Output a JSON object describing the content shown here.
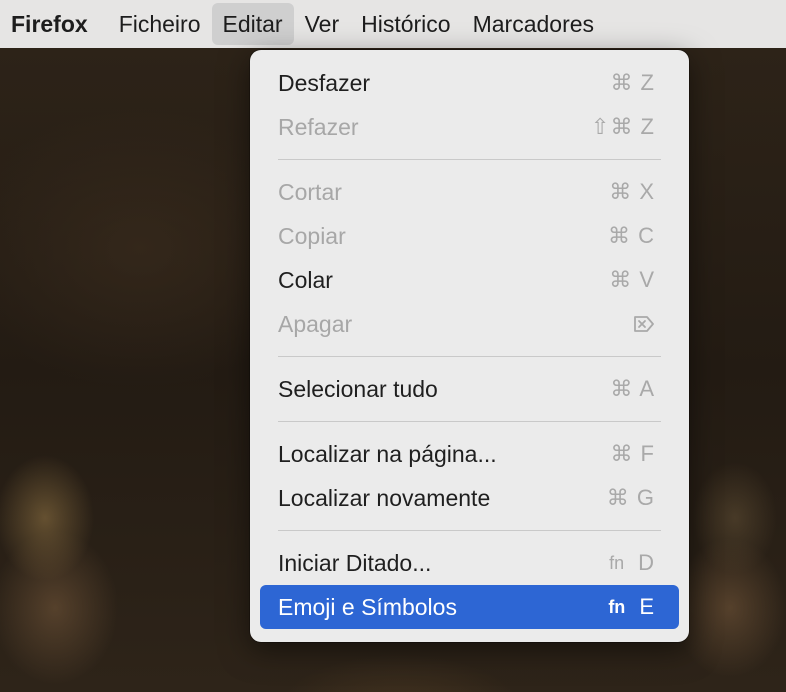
{
  "menubar": {
    "app": "Firefox",
    "items": [
      "Ficheiro",
      "Editar",
      "Ver",
      "Histórico",
      "Marcadores"
    ],
    "active_index": 1
  },
  "menu": {
    "groups": [
      [
        {
          "label": "Desfazer",
          "shortcut": "⌘ Z",
          "enabled": true
        },
        {
          "label": "Refazer",
          "shortcut": "⇧⌘ Z",
          "enabled": false
        }
      ],
      [
        {
          "label": "Cortar",
          "shortcut": "⌘ X",
          "enabled": false
        },
        {
          "label": "Copiar",
          "shortcut": "⌘ C",
          "enabled": false
        },
        {
          "label": "Colar",
          "shortcut": "⌘ V",
          "enabled": true
        },
        {
          "label": "Apagar",
          "shortcut_icon": "delete-forward-icon",
          "enabled": false
        }
      ],
      [
        {
          "label": "Selecionar tudo",
          "shortcut": "⌘ A",
          "enabled": true
        }
      ],
      [
        {
          "label": "Localizar na página...",
          "shortcut": "⌘ F",
          "enabled": true
        },
        {
          "label": "Localizar novamente",
          "shortcut": "⌘ G",
          "enabled": true
        }
      ],
      [
        {
          "label": "Iniciar Ditado...",
          "fn": "fn",
          "shortcut": "D",
          "enabled": true
        },
        {
          "label": "Emoji e Símbolos",
          "fn": "fn",
          "shortcut": "E",
          "enabled": true,
          "highlighted": true
        }
      ]
    ]
  },
  "colors": {
    "highlight": "#2d66d4",
    "menu_bg": "#ebebeb",
    "menubar_bg": "#e6e5e4"
  }
}
